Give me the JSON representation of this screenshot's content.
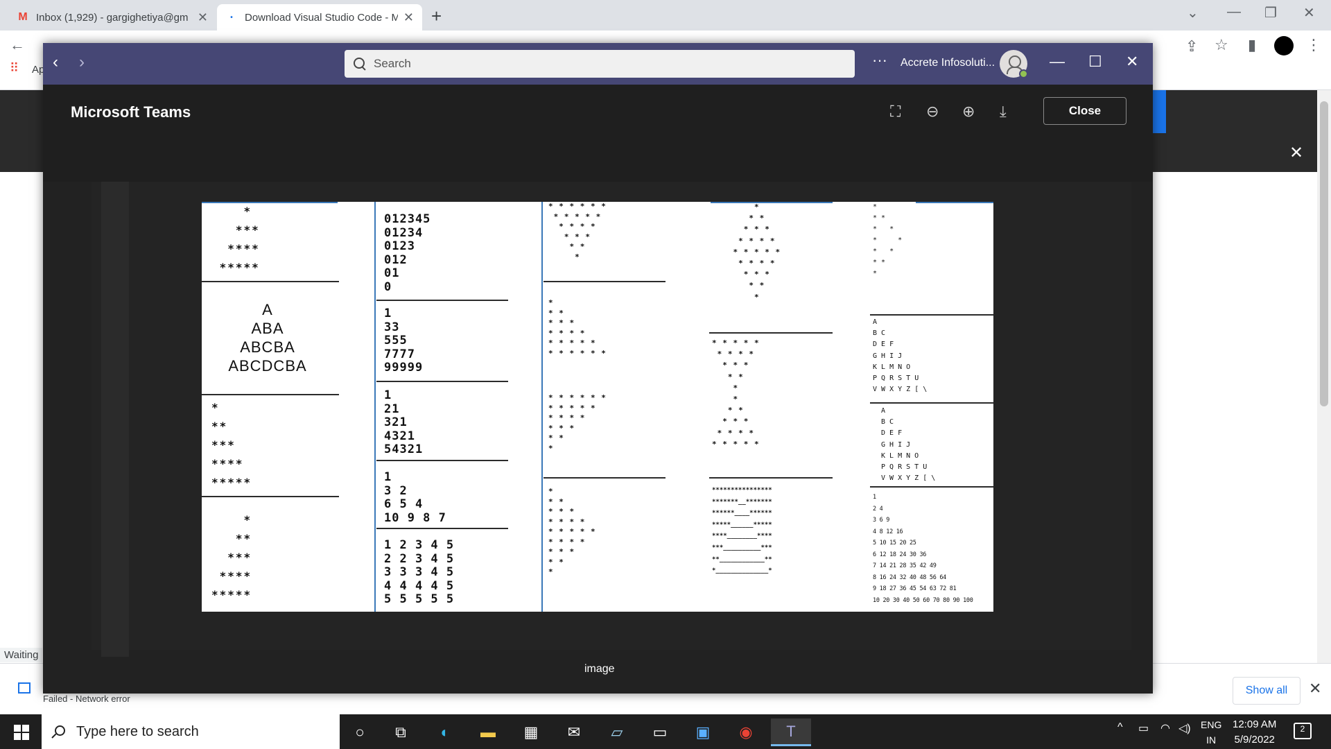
{
  "browser": {
    "tabs": [
      {
        "title": "Inbox (1,929) - gargighetiya@gm",
        "icon": "gmail-icon"
      },
      {
        "title": "Download Visual Studio Code - M",
        "icon": "loading-icon"
      }
    ],
    "new_tab_symbol": "+",
    "apps_label": "Ap",
    "status_text": "Waiting",
    "download_status": "Failed - Network error",
    "show_all_label": "Show all"
  },
  "teams": {
    "search_placeholder": "Search",
    "org_name": "Accrete Infosoluti...",
    "viewer_title": "Microsoft Teams",
    "close_label": "Close",
    "image_caption": "image",
    "presence_color": "#92c353",
    "titlebar_color": "#464775"
  },
  "image_patterns": {
    "col1": [
      "    *\n   ***\n  ****\n *****",
      "A\nABA\nABCBA\nABCDCBA",
      "*\n**\n***\n****\n*****",
      "    *\n   **\n  ***\n ****\n*****"
    ],
    "col2": [
      "012345\n01234\n0123\n012\n01\n0",
      "1\n33\n555\n7777\n99999",
      "1\n21\n321\n4321\n54321",
      "1\n3 2\n6 5 4\n10 9 8 7",
      "1 2 3 4 5\n2 2 3 4 5\n3 3 3 4 5\n4 4 4 4 5\n5 5 5 5 5"
    ],
    "col3": [
      "* * * * * *\n * * * * *\n  * * * *\n   * * *\n    * *\n     *",
      "*\n* *\n* * *\n* * * *\n* * * * *\n* * * * * *",
      "* * * * * *\n* * * * *\n* * * *\n* * *\n* *\n*",
      "*\n* *\n* * *\n* * * *\n* * * * *\n* * * *\n* * *\n* *\n*"
    ],
    "col4": [
      "        *\n       * *\n      * * *\n     * * * *\n    * * * * *\n     * * * *\n      * * *\n       * *\n        *",
      "* * * * *\n * * * *\n  * * *\n   * *\n    *\n    *\n   * *\n  * * *\n * * * *\n* * * * *",
      "****************\n*******__*******\n******____******\n*****______*****\n****________****\n***__________***\n**____________**\n*______________*"
    ],
    "col5": [
      "*\n* *\n*   *\n*     *\n*   *\n* *\n*",
      "A\nB C\nD E F\nG H I J\nK L M N O\nP Q R S T U\nV W X Y Z [ \\",
      "A\nB C\nD E F\nG H I J\nK L M N O\nP Q R S T U\nV W X Y Z [ \\",
      "1\n2 4\n3 6 9\n4 8 12 16\n5 10 15 20 25\n6 12 18 24 30 36\n7 14 21 28 35 42 49\n8 16 24 32 40 48 56 64\n9 18 27 36 45 54 63 72 81\n10 20 30 40 50 60 70 80 90 100"
    ]
  },
  "taskbar": {
    "search_placeholder": "Type here to search",
    "lang_line1": "ENG",
    "lang_line2": "IN",
    "time": "12:09 AM",
    "date": "5/9/2022",
    "notification_count": "2"
  }
}
